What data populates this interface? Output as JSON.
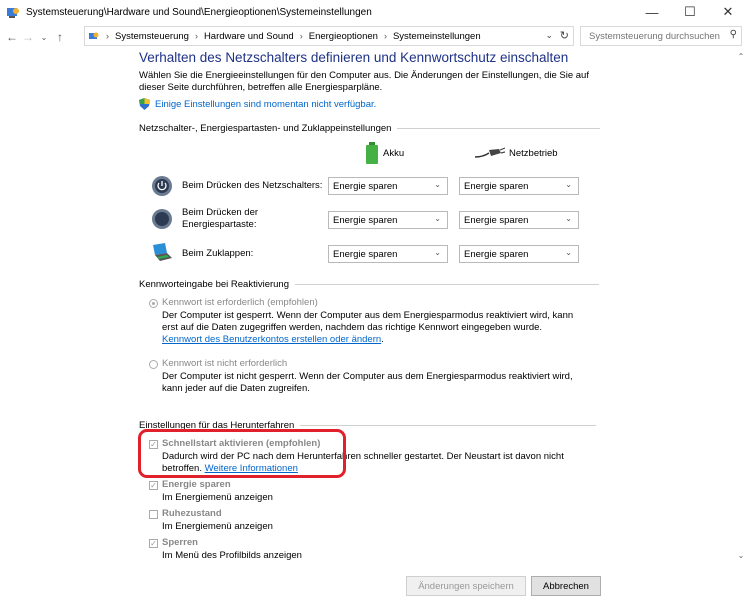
{
  "window": {
    "title": "Systemsteuerung\\Hardware und Sound\\Energieoptionen\\Systemeinstellungen"
  },
  "address": {
    "crumbs": [
      "Systemsteuerung",
      "Hardware und Sound",
      "Energieoptionen",
      "Systemeinstellungen"
    ]
  },
  "search": {
    "placeholder": "Systemsteuerung durchsuchen"
  },
  "heading": "Verhalten des Netzschalters definieren und Kennwortschutz einschalten",
  "intro": "Wählen Sie die Energieeinstellungen für den Computer aus. Die Änderungen der Einstellungen, die Sie auf dieser Seite durchführen, betreffen alle Energiesparpläne.",
  "unavailable_link": "Einige Einstellungen sind momentan nicht verfügbar.",
  "buttons_section": {
    "header": "Netzschalter-, Energiespartasten- und Zuklappeinstellungen",
    "col_battery": "Akku",
    "col_power": "Netzbetrieb",
    "rows": [
      {
        "label": "Beim Drücken des Netzschalters:",
        "battery": "Energie sparen",
        "power": "Energie sparen"
      },
      {
        "label": "Beim Drücken der Energiespartaste:",
        "battery": "Energie sparen",
        "power": "Energie sparen"
      },
      {
        "label": "Beim Zuklappen:",
        "battery": "Energie sparen",
        "power": "Energie sparen"
      }
    ]
  },
  "password_section": {
    "header": "Kennworteingabe bei Reaktivierung",
    "opt1_label": "Kennwort ist erforderlich (empfohlen)",
    "opt1_desc": "Der Computer ist gesperrt. Wenn der Computer aus dem Energiesparmodus reaktiviert wird, kann erst auf die Daten zugegriffen werden, nachdem das richtige Kennwort eingegeben wurde.",
    "opt1_link": "Kennwort des Benutzerkontos erstellen oder ändern",
    "opt2_label": "Kennwort ist nicht erforderlich",
    "opt2_desc": "Der Computer ist nicht gesperrt. Wenn der Computer aus dem Energiesparmodus reaktiviert wird, kann jeder auf die Daten zugreifen."
  },
  "shutdown_section": {
    "header": "Einstellungen für das Herunterfahren",
    "fast_label": "Schnellstart aktivieren (empfohlen)",
    "fast_desc1": "Dadurch wird der PC nach dem Herunterfahren schneller gestartet. Der Neustart ist davon nicht",
    "fast_desc2": "betroffen.",
    "fast_link": "Weitere Informationen",
    "sleep_label": "Energie sparen",
    "sleep_desc": "Im Energiemenü anzeigen",
    "hibernate_label": "Ruhezustand",
    "hibernate_desc": "Im Energiemenü anzeigen",
    "lock_label": "Sperren",
    "lock_desc": "Im Menü des Profilbilds anzeigen"
  },
  "footer": {
    "save": "Änderungen speichern",
    "cancel": "Abbrechen"
  }
}
